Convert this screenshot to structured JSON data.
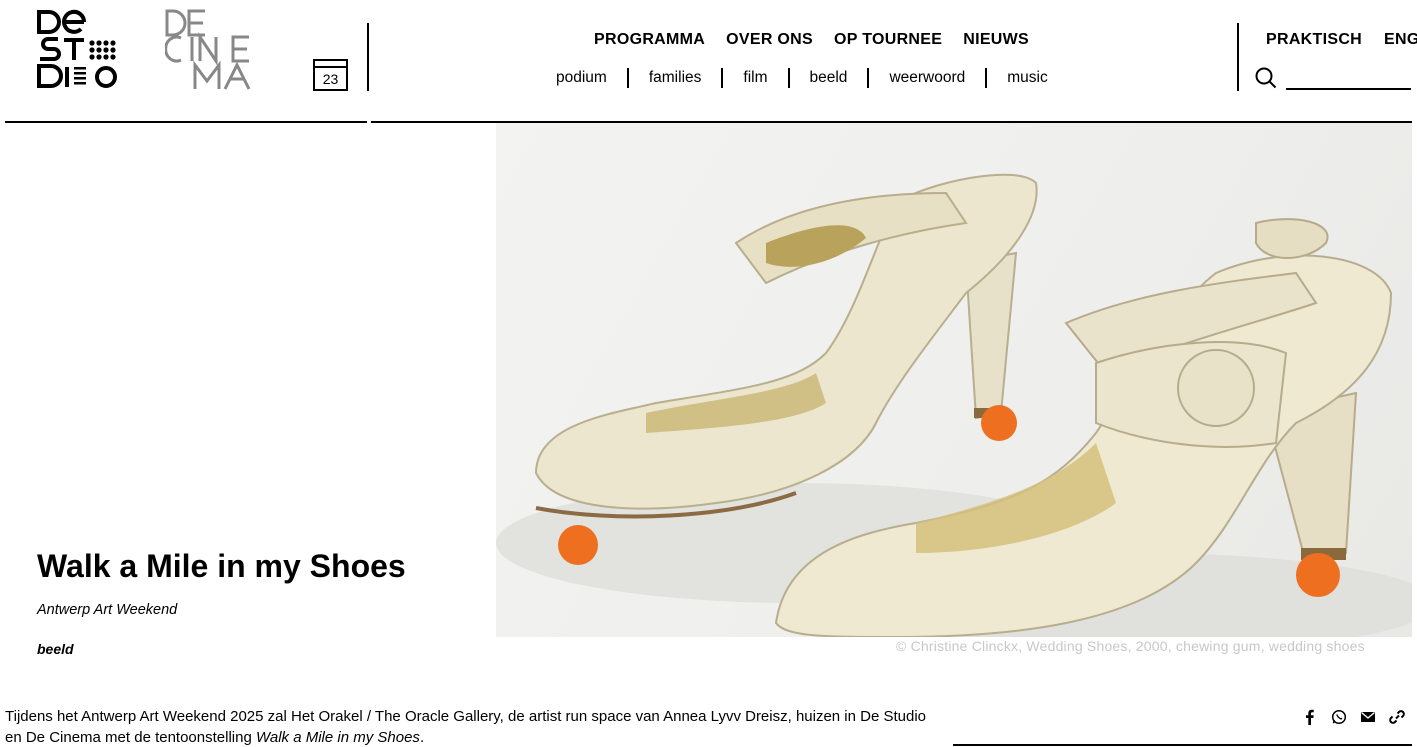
{
  "header": {
    "calendar_day": "23",
    "main_nav": [
      "PROGRAMMA",
      "OVER ONS",
      "OP TOURNEE",
      "NIEUWS"
    ],
    "sub_nav": [
      "podium",
      "families",
      "film",
      "beeld",
      "weerwoord",
      "music"
    ],
    "util_nav": [
      "PRAKTISCH",
      "ENG"
    ],
    "search_placeholder": ""
  },
  "hero": {
    "title": "Walk a Mile in my Shoes",
    "subtitle": "Antwerp Art Weekend",
    "category": "beeld",
    "caption": "© Christine Clinckx, Wedding Shoes, 2000, chewing gum, wedding shoes"
  },
  "intro": {
    "text_before": "Tijdens het Antwerp Art Weekend 2025 zal Het Orakel / The Oracle Gallery, de artist run space van Annea Lyvv Dreisz, huizen in De Studio en De Cinema met de tentoonstelling ",
    "title_italic": "Walk a Mile in my Shoes",
    "text_after": "."
  },
  "share": [
    "facebook-icon",
    "whatsapp-icon",
    "mail-icon",
    "link-icon"
  ]
}
